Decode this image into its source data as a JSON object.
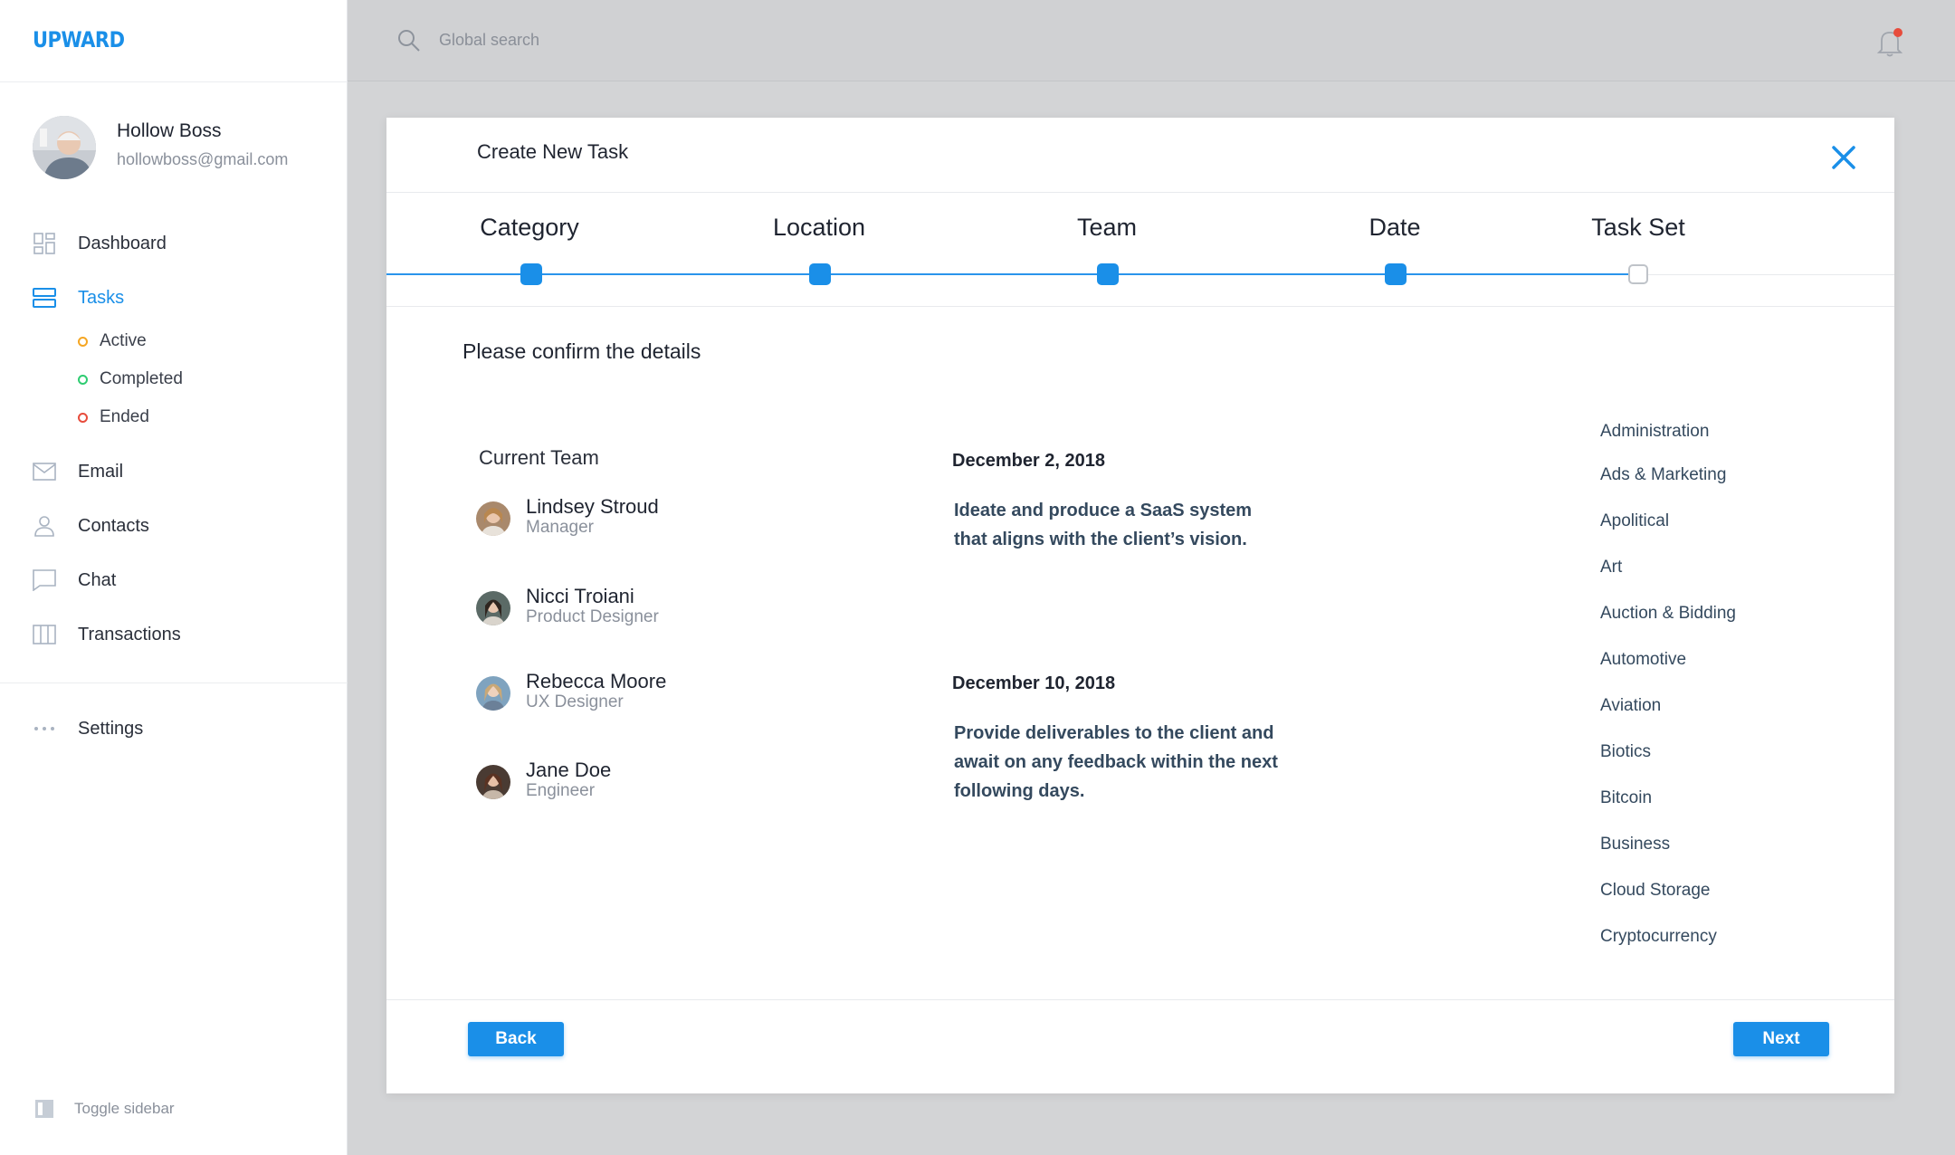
{
  "app": {
    "logo": "UPWARD"
  },
  "user": {
    "name": "Hollow Boss",
    "email": "hollowboss@gmail.com"
  },
  "nav": {
    "dashboard": "Dashboard",
    "tasks": "Tasks",
    "email": "Email",
    "contacts": "Contacts",
    "chat": "Chat",
    "transactions": "Transactions",
    "settings": "Settings"
  },
  "tasks_sub": [
    {
      "label": "Active",
      "color": "#f5a623"
    },
    {
      "label": "Completed",
      "color": "#2ecc71"
    },
    {
      "label": "Ended",
      "color": "#e74c3c"
    }
  ],
  "toggle_sidebar": "Toggle sidebar",
  "search": {
    "placeholder": "Global search"
  },
  "colors": {
    "accent": "#1a8fe8",
    "notification": "#e74c3c"
  },
  "modal": {
    "title": "Create New Task",
    "steps": [
      {
        "label": "Category",
        "done": true
      },
      {
        "label": "Location",
        "done": true
      },
      {
        "label": "Team",
        "done": true
      },
      {
        "label": "Date",
        "done": true
      },
      {
        "label": "Task Set",
        "done": false
      }
    ],
    "confirm_title": "Please confirm the details",
    "team_title": "Current Team",
    "members": [
      {
        "name": "Lindsey Stroud",
        "role": "Manager"
      },
      {
        "name": "Nicci Troiani",
        "role": "Product Designer"
      },
      {
        "name": "Rebecca Moore",
        "role": "UX Designer"
      },
      {
        "name": "Jane Doe",
        "role": "Engineer"
      }
    ],
    "schedule": [
      {
        "date": "December 2, 2018",
        "description": "Ideate and produce a SaaS system that aligns with the client’s vision."
      },
      {
        "date": "December 10, 2018",
        "description": "Provide deliverables to the client and await on any feedback within the next following days."
      }
    ],
    "categories": [
      "Administration",
      "Ads & Marketing",
      "Apolitical",
      "Art",
      "Auction & Bidding",
      "Automotive",
      "Aviation",
      "Biotics",
      "Bitcoin",
      "Business",
      "Cloud Storage",
      "Cryptocurrency"
    ],
    "back_label": "Back",
    "next_label": "Next"
  }
}
